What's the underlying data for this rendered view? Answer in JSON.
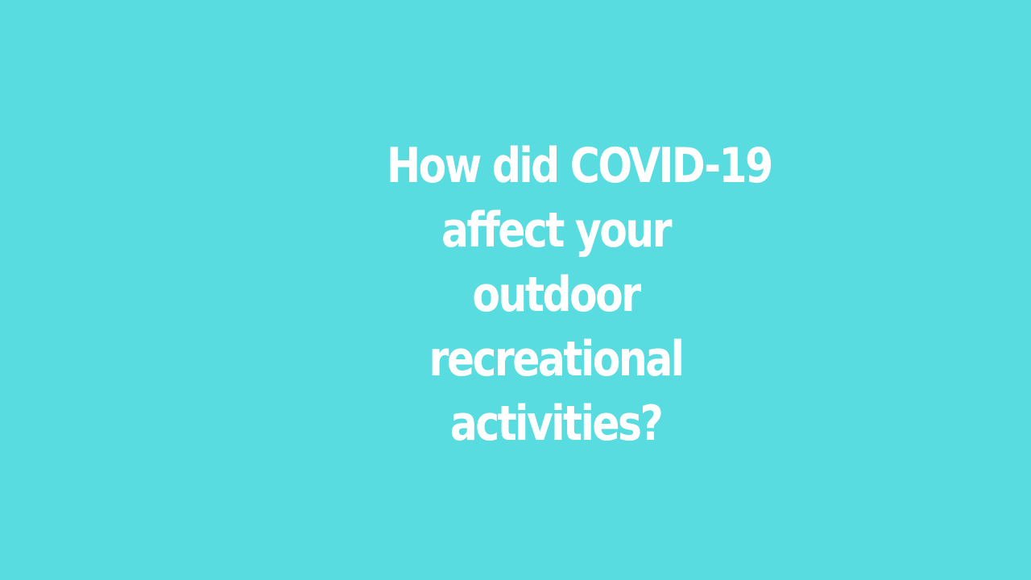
{
  "slide": {
    "background_color": "#59dcdf",
    "text_color": "#ffffff",
    "question_lines": [
      "How did COVID-19",
      "affect your",
      "outdoor",
      "recreational",
      "activities?"
    ]
  }
}
